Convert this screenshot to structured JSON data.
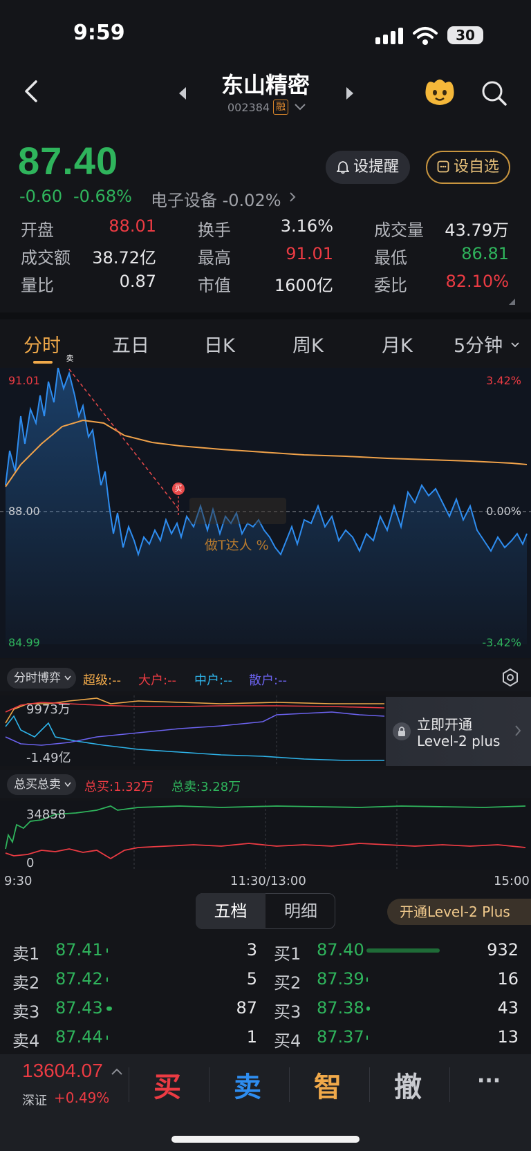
{
  "status_bar": {
    "time": "9:59",
    "battery": "30"
  },
  "header": {
    "stock_name": "东山精密",
    "stock_code": "002384",
    "margin_badge": "融"
  },
  "quote": {
    "price": "87.40",
    "change": "-0.60",
    "change_pct": "-0.68%",
    "sector": "电子设备 -0.02%",
    "alert_button": "设提醒",
    "favorite_button": "设自选"
  },
  "stats": [
    {
      "label": "开盘",
      "value": "88.01",
      "color": "red"
    },
    {
      "label": "换手",
      "value": "3.16%",
      "color": "white"
    },
    {
      "label": "成交量",
      "value": "43.79万",
      "color": "white"
    },
    {
      "label": "成交额",
      "value": "38.72亿",
      "color": "white"
    },
    {
      "label": "最高",
      "value": "91.01",
      "color": "red"
    },
    {
      "label": "最低",
      "value": "86.81",
      "color": "green"
    },
    {
      "label": "量比",
      "value": "0.87",
      "color": "white"
    },
    {
      "label": "市值",
      "value": "1600亿",
      "color": "white"
    },
    {
      "label": "委比",
      "value": "82.10%",
      "color": "red"
    }
  ],
  "tabs": [
    "分时",
    "五日",
    "日K",
    "周K",
    "月K",
    "5分钟"
  ],
  "intraday_chart": {
    "y_high": "91.01",
    "y_mid": "88.00",
    "y_low": "84.99",
    "pct_high": "3.42%",
    "pct_mid": "0.00%",
    "pct_low": "-3.42%",
    "sell_marker": "卖",
    "buy_marker": "买",
    "watermark": "做T达人 %",
    "colors": {
      "price": "#2e8df0",
      "avg": "#f0a24a"
    }
  },
  "game_panel": {
    "dropdown": "分时博弈",
    "legend": [
      {
        "label": "超级:--",
        "color": "#f0a94a"
      },
      {
        "label": "大户:--",
        "color": "#ec3b43"
      },
      {
        "label": "中户:--",
        "color": "#2eb4ea"
      },
      {
        "label": "散户:--",
        "color": "#6c63f0"
      }
    ],
    "top_value": "9973万",
    "bottom_value": "-1.49亿",
    "level2_title": "立即开通",
    "level2_sub": "Level-2 plus"
  },
  "buysell_panel": {
    "dropdown": "总买总卖",
    "total_buy": "总买:1.32万",
    "total_sell": "总卖:3.28万",
    "top_value": "34858",
    "bottom_value": "0"
  },
  "time_axis": [
    "9:30",
    "11:30/13:00",
    "15:00"
  ],
  "orderbook": {
    "tab_depth": "五档",
    "tab_detail": "明细",
    "level2_button": "开通Level-2 Plus",
    "asks": [
      {
        "label": "卖1",
        "price": "87.41",
        "qty": "3"
      },
      {
        "label": "卖2",
        "price": "87.42",
        "qty": "5"
      },
      {
        "label": "卖3",
        "price": "87.43",
        "qty": "87"
      },
      {
        "label": "卖4",
        "price": "87.44",
        "qty": "1"
      }
    ],
    "bids": [
      {
        "label": "买1",
        "price": "87.40",
        "qty": "932"
      },
      {
        "label": "买2",
        "price": "87.39",
        "qty": "16"
      },
      {
        "label": "买3",
        "price": "87.38",
        "qty": "43"
      },
      {
        "label": "买4",
        "price": "87.37",
        "qty": "13"
      }
    ]
  },
  "bottom_bar": {
    "index_value": "13604.07",
    "index_name": "深证",
    "index_change": "+0.49%",
    "buy": "买",
    "sell": "卖",
    "smart": "智",
    "cancel": "撤",
    "more": "···"
  }
}
